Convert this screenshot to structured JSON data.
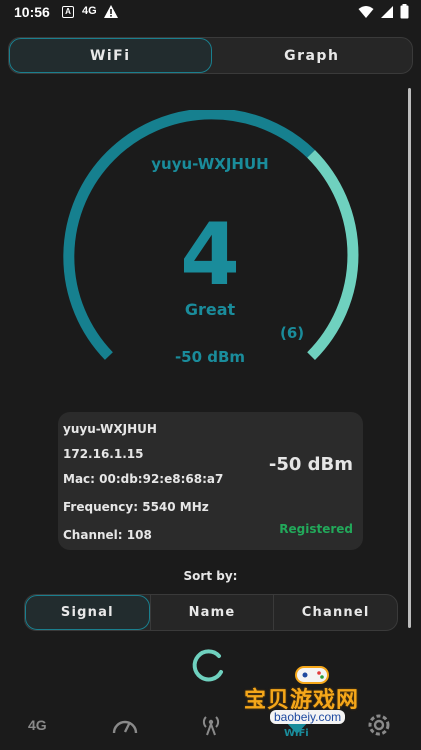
{
  "status_bar": {
    "time": "10:56",
    "notification_letter": "A",
    "network": "4G",
    "icons": [
      "alert-icon",
      "wifi-icon",
      "signal-icon",
      "battery-icon"
    ]
  },
  "top_tabs": [
    {
      "label": "WiFi",
      "active": true
    },
    {
      "label": "Graph",
      "active": false
    }
  ],
  "gauge": {
    "ssid": "yuyu-WXJHUH",
    "level": "4",
    "level_value": 4,
    "max_label": "(6)",
    "max_value": 6,
    "quality": "Great",
    "signal": "-50 dBm",
    "colors": {
      "track": "#16808f",
      "progress": "#6fd1bf"
    }
  },
  "info_card": {
    "ssid": "yuyu-WXJHUH",
    "ip": "172.16.1.15",
    "mac": "Mac: 00:db:92:e8:68:a7",
    "frequency": "Frequency: 5540 MHz",
    "channel": "Channel: 108",
    "signal": "-50 dBm",
    "status": "Registered",
    "status_color": "#22a85a"
  },
  "sort": {
    "label": "Sort by:",
    "options": [
      {
        "label": "Signal",
        "active": true
      },
      {
        "label": "Name",
        "active": false
      },
      {
        "label": "Channel",
        "active": false
      }
    ]
  },
  "bottom_nav": {
    "items": [
      {
        "label": "4G",
        "icon": "text-4g"
      },
      {
        "icon": "speedometer-icon"
      },
      {
        "icon": "antenna-icon"
      },
      {
        "icon": "wifi-icon",
        "label": "WiFi"
      },
      {
        "icon": "settings-icon"
      }
    ]
  },
  "watermark": {
    "text": "宝贝游戏网",
    "url": "baobeiy.com"
  },
  "accent_color": "#1a8c9b"
}
